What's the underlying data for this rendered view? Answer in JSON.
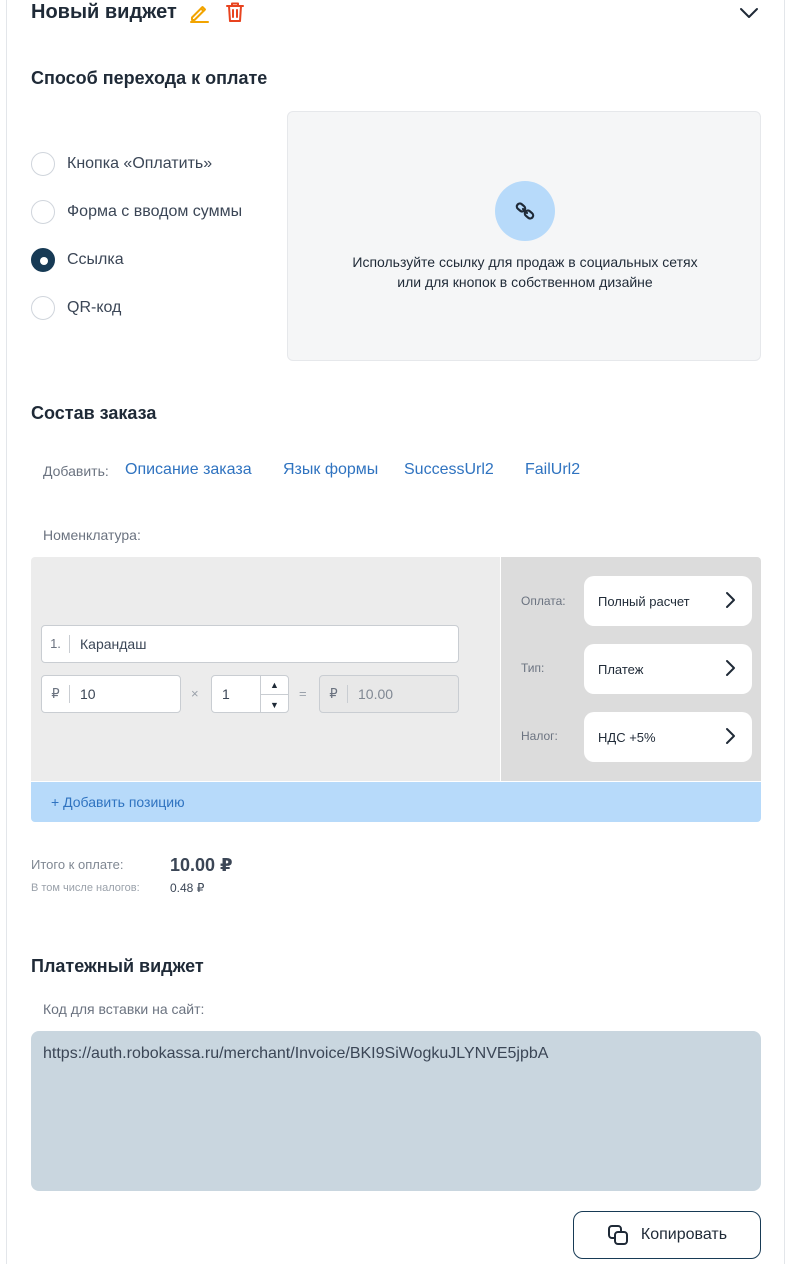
{
  "header": {
    "title": "Новый виджет",
    "edit_icon": "pencil-icon",
    "delete_icon": "trash-icon",
    "collapse_icon": "chevron-down-icon",
    "colors": {
      "edit": "#f2a400",
      "delete": "#e8431f"
    }
  },
  "payment_method": {
    "title": "Способ перехода к оплате",
    "options": [
      {
        "label": "Кнопка «Оплатить»",
        "checked": false
      },
      {
        "label": "Форма с вводом суммы",
        "checked": false
      },
      {
        "label": "Ссылка",
        "checked": true
      },
      {
        "label": "QR-код",
        "checked": false
      }
    ],
    "info": {
      "icon": "link-icon",
      "line1": "Используйте ссылку для продаж в социальных сетях",
      "line2": "или для кнопок в собственном дизайне"
    }
  },
  "order": {
    "title": "Состав заказа",
    "add_label": "Добавить:",
    "add_links": [
      "Описание заказа",
      "Язык формы",
      "SuccessUrl2",
      "FailUrl2"
    ],
    "nomenclature_label": "Номенклатура:",
    "item": {
      "index": "1.",
      "name": "Карандаш",
      "currency": "₽",
      "price": "10",
      "times": "×",
      "quantity": "1",
      "equals": "=",
      "sum": "10.00"
    },
    "params": [
      {
        "label": "Оплата:",
        "value": "Полный расчет"
      },
      {
        "label": "Тип:",
        "value": "Платеж"
      },
      {
        "label": "Налог:",
        "value": "НДС +5%"
      }
    ],
    "add_position": "+ Добавить позицию"
  },
  "totals": {
    "total_label": "Итого к оплате:",
    "total_value": "10.00 ₽",
    "tax_label": "В том числе налогов:",
    "tax_value": "0.48 ₽"
  },
  "widget": {
    "title": "Платежный виджет",
    "code_label": "Код для вставки на сайт:",
    "code": "https://auth.robokassa.ru/merchant/Invoice/BKI9SiWogkuJLYNVE5jpbA",
    "copy_label": "Копировать",
    "copy_icon": "copy-icon"
  },
  "colors": {
    "accent": "#173a55",
    "link": "#2f73c0",
    "highlight": "#b7dafa"
  }
}
